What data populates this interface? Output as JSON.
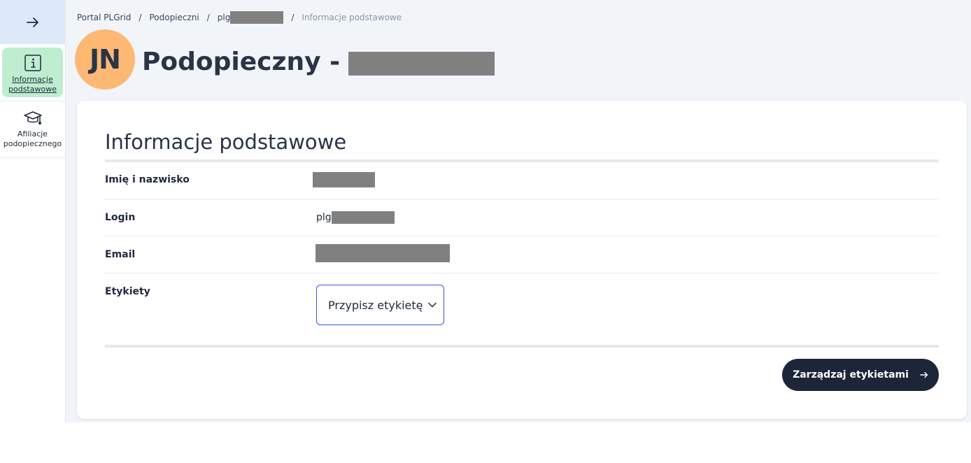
{
  "sidebar": {
    "toggle_icon": "arrow-right-icon",
    "items": [
      {
        "label_line1": "Informacje",
        "label_line2": "podstawowe",
        "icon": "info-icon",
        "active": true
      },
      {
        "label_line1": "Afiliacje",
        "label_line2": "podopiecznego",
        "icon": "graduation-cap-icon",
        "active": false
      }
    ]
  },
  "breadcrumb": {
    "items": [
      "Portal PLGrid",
      "Podopieczni",
      "plg",
      "Informacje podstawowe"
    ],
    "separator": "/"
  },
  "header": {
    "avatar_initials": "JN",
    "title_prefix": "Podopieczny -"
  },
  "card": {
    "title": "Informacje podstawowe",
    "rows": [
      {
        "label": "Imię i nazwisko",
        "value": ""
      },
      {
        "label": "Login",
        "value": "plg"
      },
      {
        "label": "Email",
        "value": ""
      },
      {
        "label": "Etykiety",
        "value": ""
      }
    ],
    "tag_select_label": "Przypisz etykietę",
    "manage_button_label": "Zarządzaj etykietami"
  },
  "colors": {
    "accent_active": "#bfedd0",
    "avatar": "#fdb873",
    "primary_button": "#1c2638",
    "select_border": "#2d5bd7",
    "toggle_bg": "#dde9f9"
  }
}
